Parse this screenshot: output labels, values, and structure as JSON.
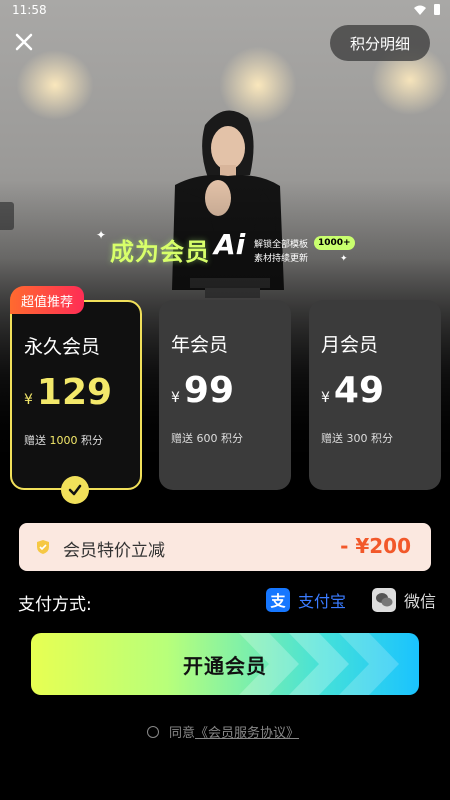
{
  "status_bar": {
    "time": "11:58"
  },
  "header": {
    "points_button_label": "积分明细"
  },
  "promo": {
    "headline": "成为会员",
    "ai_text": "Ai",
    "line1": "解锁全部模板",
    "line2": "素材持续更新",
    "badge": "1000+"
  },
  "plans": {
    "tag": "超值推荐",
    "items": [
      {
        "name": "永久会员",
        "currency": "¥",
        "price": "129",
        "gift_prefix": "赠送",
        "gift_points": "1000",
        "gift_suffix": "积分"
      },
      {
        "name": "年会员",
        "currency": "¥",
        "price": "99",
        "gift_prefix": "赠送",
        "gift_points": "600",
        "gift_suffix": "积分"
      },
      {
        "name": "月会员",
        "currency": "¥",
        "price": "49",
        "gift_prefix": "赠送",
        "gift_points": "300",
        "gift_suffix": "积分"
      }
    ]
  },
  "discount": {
    "label": "会员特价立减",
    "value": "- ¥200"
  },
  "payment": {
    "label": "支付方式:",
    "alipay_label": "支付宝",
    "alipay_icon_char": "支",
    "wechat_label": "微信"
  },
  "cta": {
    "label": "开通会员"
  },
  "agreement": {
    "prefix": "同意",
    "link": "《会员服务协议》"
  },
  "colors": {
    "accent_yellow": "#f1e05a",
    "discount_red": "#f2582a",
    "alipay_blue": "#1677ff"
  }
}
